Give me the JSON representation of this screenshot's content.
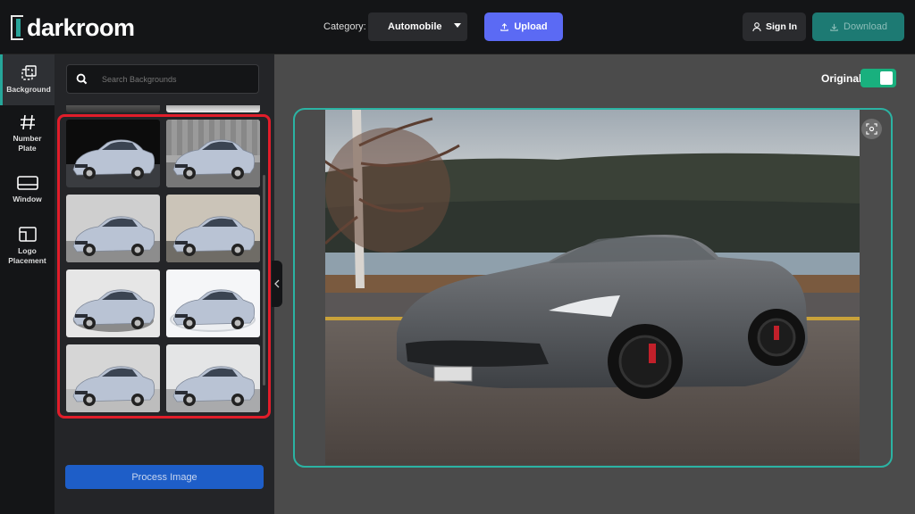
{
  "app": {
    "logo_text": "darkroom"
  },
  "header": {
    "category_label": "Category:",
    "category_value": "Automobile",
    "upload_label": "Upload",
    "signin_label": "Sign In",
    "download_label": "Download"
  },
  "sidebar": {
    "items": [
      {
        "label": "Background",
        "icon": "background-icon",
        "active": true
      },
      {
        "label": "Number Plate",
        "icon": "hash-icon",
        "active": false
      },
      {
        "label": "Window",
        "icon": "window-icon",
        "active": false
      },
      {
        "label": "Logo Placement",
        "icon": "logo-placement-icon",
        "active": false
      }
    ]
  },
  "panel": {
    "search_placeholder": "Search Backgrounds",
    "backgrounds": [
      {
        "style": "black"
      },
      {
        "style": "wood-wall"
      },
      {
        "style": "white-studio"
      },
      {
        "style": "beige-studio"
      },
      {
        "style": "turntable-grey"
      },
      {
        "style": "white-ring"
      },
      {
        "style": "light-grey"
      },
      {
        "style": "soft-white"
      }
    ],
    "process_label": "Process Image"
  },
  "workspace": {
    "original_label": "Original",
    "original_toggle_on": true
  },
  "colors": {
    "accent_teal": "#2bb3a3",
    "upload_blue": "#5b6af4",
    "highlight_red": "#e11d2a",
    "toggle_green": "#19b07e"
  }
}
